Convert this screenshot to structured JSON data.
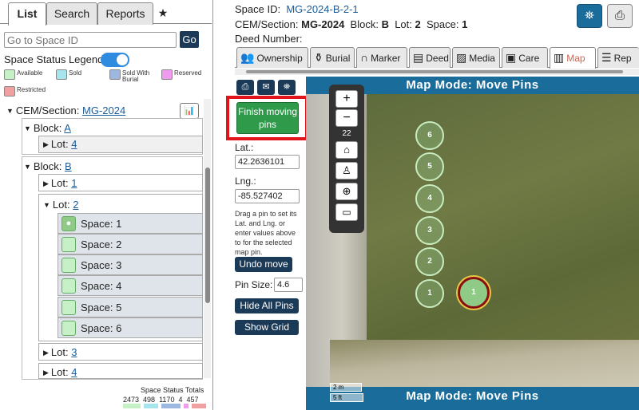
{
  "left": {
    "tabs": [
      {
        "label": "List"
      },
      {
        "label": "Search"
      },
      {
        "label": "Reports"
      },
      {
        "label": "★"
      }
    ],
    "go_placeholder": "Go to Space ID",
    "go_label": "Go",
    "legend_title": "Space Status Legend:",
    "legend": [
      {
        "label": "Available",
        "color": "#c6f0c6"
      },
      {
        "label": "Sold",
        "color": "#a8e4ec"
      },
      {
        "label": "Sold With Burial",
        "color": "#9cb8e0"
      },
      {
        "label": "Reserved",
        "color": "#f09af0"
      },
      {
        "label": "Restricted",
        "color": "#f0a0a0"
      }
    ],
    "tree": {
      "cem_label": "CEM/Section:",
      "cem_link": "MG-2024",
      "block_label": "Block:",
      "lot_label": "Lot:",
      "space_label": "Space:",
      "block_a": "A",
      "lot_a4": "4",
      "block_b": "B",
      "lot_b1": "1",
      "lot_b2": "2",
      "lot_b3": "3",
      "lot_b4": "4",
      "spaces": [
        "1",
        "2",
        "3",
        "4",
        "5",
        "6"
      ]
    },
    "totals_title": "Space Status Totals",
    "totals": [
      "2473",
      "498",
      "1170",
      "4",
      "457"
    ]
  },
  "right": {
    "space_id_label": "Space ID:",
    "space_id": "MG-2024-B-2-1",
    "cem_label": "CEM/Section:",
    "cem_value": "MG-2024",
    "block_label": "Block:",
    "block_value": "B",
    "lot_label": "Lot:",
    "lot_value": "2",
    "space_label": "Space:",
    "space_value": "1",
    "deed_label": "Deed Number:",
    "tabs": [
      {
        "label": "Ownership",
        "icon": "people-icon"
      },
      {
        "label": "Burial",
        "icon": "casket-icon"
      },
      {
        "label": "Marker",
        "icon": "headstone-icon"
      },
      {
        "label": "Deed",
        "icon": "document-icon"
      },
      {
        "label": "Media",
        "icon": "image-icon"
      },
      {
        "label": "Care",
        "icon": "money-icon"
      },
      {
        "label": "Map",
        "icon": "map-icon"
      },
      {
        "label": "Rep",
        "icon": "list-icon"
      }
    ],
    "finish_label": "Finish moving pins",
    "lat_label": "Lat.:",
    "lat_value": "42.2636101",
    "lng_label": "Lng.:",
    "lng_value": "-85.527402",
    "help_text": "Drag a pin to set its Lat. and Lng. or enter values above to for the selected map pin.",
    "undo_label": "Undo move",
    "pin_size_label": "Pin Size:",
    "pin_size_value": "4.6",
    "hide_pins_label": "Hide All Pins",
    "show_grid_label": "Show Grid"
  },
  "map": {
    "mode_title": "Map Mode: Move Pins",
    "zoom_level": "22",
    "zoom_in": "+",
    "zoom_out": "−",
    "pins": [
      "6",
      "5",
      "4",
      "3",
      "2",
      "1"
    ],
    "selected_pin": "1",
    "scale_m": "2 m",
    "scale_ft": "5 ft"
  },
  "colors": {
    "navy": "#1b3a57",
    "map_bar": "#1a6c9b",
    "finish_green": "#2f9a4a",
    "highlight_red": "#e0151c"
  }
}
